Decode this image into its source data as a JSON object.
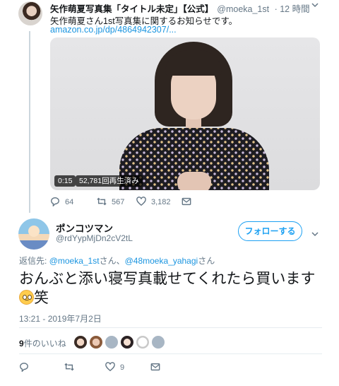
{
  "parent_tweet": {
    "author_name": "矢作萌夏写真集「タイトル未定」【公式】",
    "handle": "@moeka_1st",
    "time": "· 12 時間",
    "text": "矢作萌夏さん1st写真集に関するお知らせです。",
    "link": "amazon.co.jp/dp/4864942307/...",
    "video": {
      "duration": "0:15",
      "views": "52,781回再生済み"
    },
    "actions": {
      "replies": "64",
      "retweets": "567",
      "likes": "3,182"
    }
  },
  "main_tweet": {
    "author_name": "ポンコツマン",
    "handle": "@rdYypMjDn2cV2tL",
    "follow_label": "フォローする",
    "reply_prefix": "返信先:",
    "reply_mention_1": "@moeka_1st",
    "reply_sep": "さん、",
    "reply_mention_2": "@48moeka_yahagi",
    "reply_suffix": "さん",
    "text_line1": "おんぶと添い寝写真載せてくれたら買います",
    "text_line2": "笑",
    "timestamp": "13:21 - 2019年7月2日",
    "likes_count": "9",
    "likes_label": "件のいいね",
    "actions": {
      "likes": "9"
    }
  },
  "icons": [
    "more-icon",
    "reply-icon",
    "retweet-icon",
    "heart-icon",
    "mail-icon",
    "chevron-down-icon",
    "emoji-pleading-icon"
  ],
  "colors": {
    "accent": "#1da1f2",
    "link": "#1b95e0",
    "muted": "#657786",
    "text": "#14171a"
  }
}
